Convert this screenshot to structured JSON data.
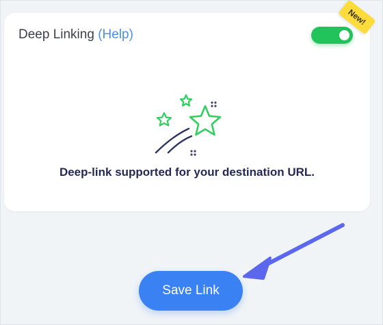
{
  "card": {
    "title": "Deep Linking",
    "help_label": "(Help)",
    "toggle_on": true,
    "badge": "New!",
    "message": "Deep-link supported for your destination URL."
  },
  "actions": {
    "save_label": "Save Link"
  },
  "icons": {
    "illustration": "shooting-stars-icon",
    "arrow": "pointer-arrow-icon"
  },
  "colors": {
    "toggle": "#21c35a",
    "badge": "#fbdc3a",
    "primary": "#3a82f4",
    "help_link": "#4a8fe6",
    "message": "#232856",
    "star_stroke": "#2ecf5e",
    "arrow": "#5b67ec"
  }
}
